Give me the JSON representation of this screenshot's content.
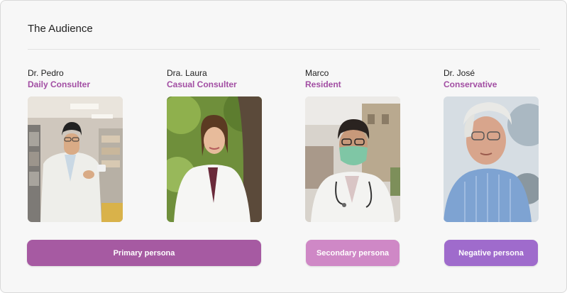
{
  "section": {
    "title": "The Audience"
  },
  "personas": [
    {
      "name": "Dr. Pedro",
      "role": "Daily Consulter",
      "photo_icon": "pharmacist-photo"
    },
    {
      "name": "Dra. Laura",
      "role": "Casual Consulter",
      "photo_icon": "doctor-outdoor-photo"
    },
    {
      "name": "Marco",
      "role": "Resident",
      "photo_icon": "masked-doctor-photo"
    },
    {
      "name": "Dr. José",
      "role": "Conservative",
      "photo_icon": "elderly-man-photo"
    }
  ],
  "segments": {
    "primary": "Primary persona",
    "secondary": "Secondary persona",
    "negative": "Negative persona"
  },
  "colors": {
    "role_accent": "#a24ea3",
    "primary_pill": "#a65aa2",
    "secondary_pill": "#cf88c6",
    "negative_pill": "#9f6bcc"
  }
}
